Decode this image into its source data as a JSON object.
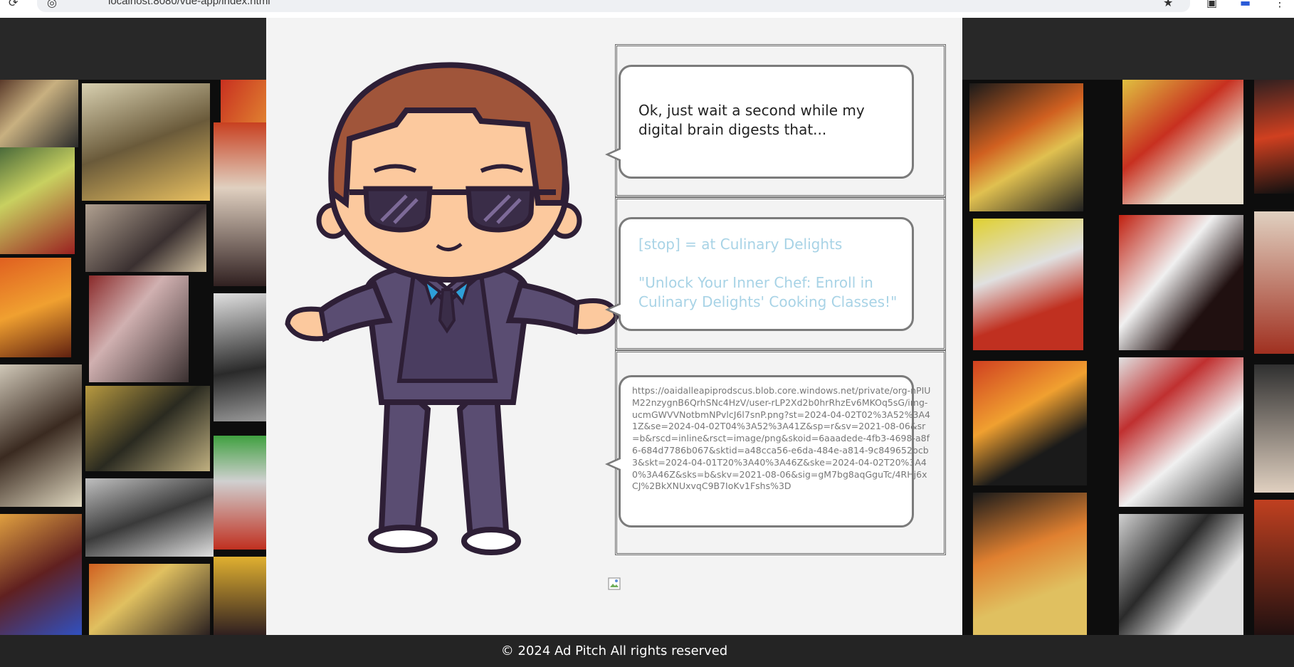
{
  "browser": {
    "url": "localhost:8080/vue-app/index.html",
    "star_icon": "star-icon",
    "extensions_icon": "extensions-icon",
    "profile_icon": "profile-icon",
    "menu_icon": "kebab-menu-icon"
  },
  "chat": {
    "message_1": "Ok, just wait a second while my digital brain digests that...",
    "message_2_intro": "[stop] = at Culinary Delights",
    "message_2_pitch": "\"Unlock Your Inner Chef: Enroll in Culinary Delights' Cooking Classes!\"",
    "message_3_url": "https://oaidalleapiprodscus.blob.core.windows.net/private/org-nPIUM22nzygnB6QrhSNc4HzV/user-rLP2Xd2b0hrRhzEv6MKOq5sG/img-ucmGWVVNotbmNPvlcJ6l7snP.png?st=2024-04-02T02%3A52%3A41Z&se=2024-04-02T04%3A52%3A41Z&sp=r&sv=2021-08-06&sr=b&rscd=inline&rsct=image/png&skoid=6aaadede-4fb3-4698-a8f6-684d7786b067&sktid=a48cca56-e6da-484e-a814-9c849652bcb3&skt=2024-04-01T20%3A40%3A46Z&ske=2024-04-02T20%3A40%3A46Z&sks=b&skv=2021-08-06&sig=gM7bg8aqGguTc/4RHj6xCJ%2BkXNUxvqC9B7IoKv1Fshs%3D"
  },
  "footer": {
    "text": "© 2024 Ad Pitch All rights reserved"
  },
  "colors": {
    "page_bg": "#242424",
    "panel_bg": "#f3f3f3",
    "pitch_text": "#a8d3e6",
    "bubble_border": "#7b7b7b"
  }
}
